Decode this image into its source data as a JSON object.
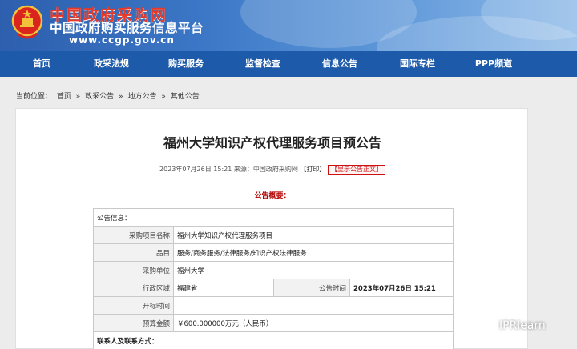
{
  "site": {
    "title": "中国政府采购网",
    "subtitle": "中国政府购买服务信息平台",
    "url": "www.ccgp.gov.cn"
  },
  "nav": [
    "首页",
    "政采法规",
    "购买服务",
    "监督检查",
    "信息公告",
    "国际专栏",
    "PPP频道"
  ],
  "breadcrumb": {
    "prefix": "当前位置：",
    "items": [
      "首页",
      "政采公告",
      "地方公告",
      "其他公告"
    ],
    "separator": "»"
  },
  "article": {
    "title": "福州大学知识产权代理服务项目预公告",
    "datetime": "2023年07月26日 15:21",
    "source_label": "来源：",
    "source": "中国政府采购网",
    "print_label": "【打印】",
    "show_full_label": "【显示公告正文】",
    "summary_label": "公告概要："
  },
  "info_table": {
    "section_title": "公告信息：",
    "rows": [
      {
        "label": "采购项目名称",
        "value": "福州大学知识产权代理服务项目"
      },
      {
        "label": "品目",
        "value": "服务/商务服务/法律服务/知识产权法律服务"
      },
      {
        "label": "采购单位",
        "value": "福州大学"
      },
      {
        "label": "行政区域",
        "value": "福建省",
        "label2": "公告时间",
        "value2": "2023年07月26日 15:21"
      },
      {
        "label": "开标时间",
        "value": ""
      },
      {
        "label": "预算金额",
        "value": "￥600.000000万元（人民币）"
      }
    ],
    "contact_title": "联系人及联系方式："
  },
  "watermark": "IPRlearn",
  "colors": {
    "nav_bg": "#1d5aa9",
    "title_red": "#e53a2a",
    "summary_red": "#b40000"
  }
}
